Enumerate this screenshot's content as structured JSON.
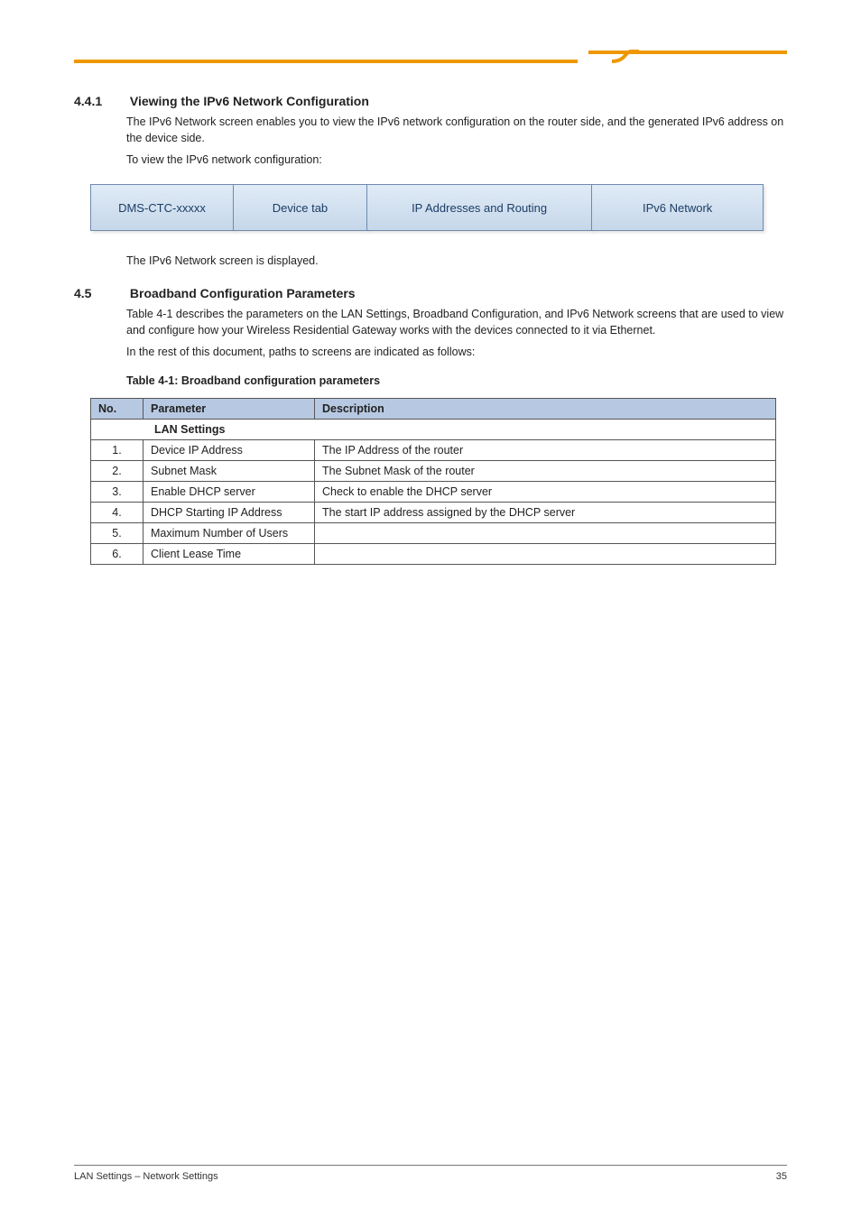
{
  "sections": {
    "s441": {
      "num": "4.4.1",
      "title": "Viewing the IPv6 Network Configuration",
      "p1": "The IPv6 Network screen enables you to view the IPv6 network configuration on the router side, and the generated IPv6 address on the device side.",
      "p2": "To view the IPv6 network configuration:"
    },
    "nav": {
      "c1": "DMS-CTC-xxxxx",
      "c2": "Device tab",
      "c3": "IP Addresses and Routing",
      "c4": "IPv6 Network"
    },
    "post_nav_p": "The IPv6 Network screen is displayed.",
    "s45": {
      "num": "4.5",
      "title": "Broadband Configuration Parameters",
      "p1": "Table 4-1 describes the parameters on the LAN Settings, Broadband Configuration, and IPv6 Network screens that are used to view and configure how your Wireless Residential Gateway works with the devices connected to it via Ethernet."
    },
    "intro_p": "In the rest of this document, paths to screens are indicated as follows:",
    "table_caption": "Table 4-1: Broadband configuration parameters",
    "table_headers": [
      "No.",
      "Parameter",
      "Description"
    ],
    "table_note": "LAN Settings",
    "table_rows": [
      {
        "no": "1.",
        "param": "Device IP Address",
        "desc": "The IP Address of the router"
      },
      {
        "no": "2.",
        "param": "Subnet Mask",
        "desc": "The Subnet Mask of the router"
      },
      {
        "no": "3.",
        "param": "Enable DHCP server",
        "desc": "Check to enable the DHCP server"
      },
      {
        "no": "4.",
        "param": "DHCP Starting IP Address",
        "desc": "The start IP address assigned by the DHCP server"
      },
      {
        "no": "5.",
        "param": "Maximum Number of Users",
        "desc": ""
      },
      {
        "no": "6.",
        "param": "Client Lease Time",
        "desc": ""
      }
    ]
  },
  "footer": {
    "left": "LAN Settings – Network Settings",
    "right": "35"
  }
}
